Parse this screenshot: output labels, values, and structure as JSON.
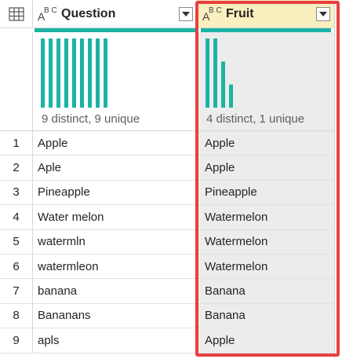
{
  "columns": [
    {
      "type_icon_a": "A",
      "type_icon_bc": "B C",
      "name": "Question",
      "profile_text": "9 distinct, 9 unique",
      "distribution": [
        1,
        1,
        1,
        1,
        1,
        1,
        1,
        1,
        1
      ]
    },
    {
      "type_icon_a": "A",
      "type_icon_bc": "B C",
      "name": "Fruit",
      "profile_text": "4 distinct, 1 unique",
      "distribution": [
        3,
        3,
        2,
        1
      ]
    }
  ],
  "colors": {
    "accent_teal": "#1bb3a3",
    "highlight_red": "#e8403f",
    "selected_header": "#f9efbf",
    "selected_column": "#ececec"
  },
  "rows": [
    {
      "num": "1",
      "question": "Apple",
      "fruit": "Apple"
    },
    {
      "num": "2",
      "question": "Aple",
      "fruit": "Apple"
    },
    {
      "num": "3",
      "question": "Pineapple",
      "fruit": "Pineapple"
    },
    {
      "num": "4",
      "question": "Water melon",
      "fruit": "Watermelon"
    },
    {
      "num": "5",
      "question": "watermln",
      "fruit": "Watermelon"
    },
    {
      "num": "6",
      "question": "watermleon",
      "fruit": "Watermelon"
    },
    {
      "num": "7",
      "question": "banana",
      "fruit": "Banana"
    },
    {
      "num": "8",
      "question": "Bananans",
      "fruit": "Banana"
    },
    {
      "num": "9",
      "question": "apls",
      "fruit": "Apple"
    }
  ]
}
